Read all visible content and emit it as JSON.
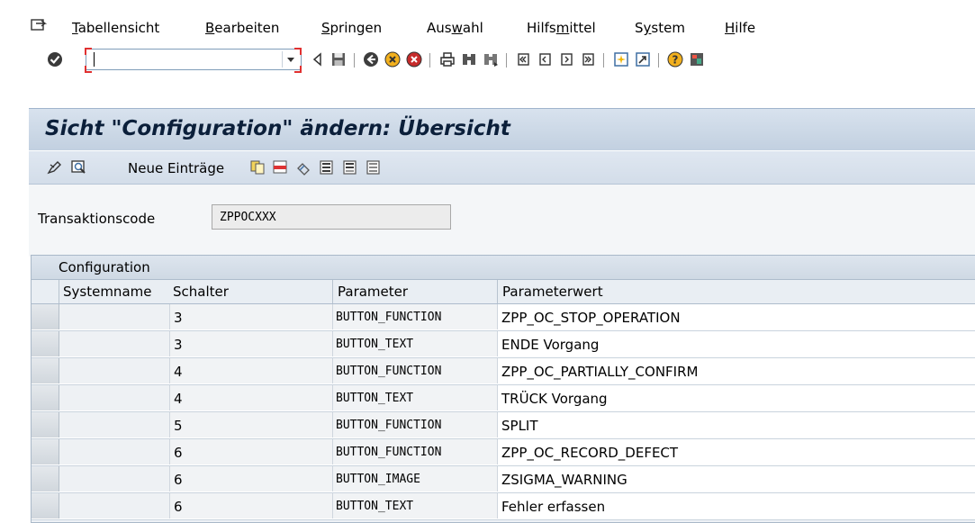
{
  "menu": {
    "items": [
      {
        "pre": "",
        "u": "T",
        "post": "abellensicht"
      },
      {
        "pre": "",
        "u": "B",
        "post": "earbeiten"
      },
      {
        "pre": "",
        "u": "S",
        "post": "pringen"
      },
      {
        "pre": "Aus",
        "u": "w",
        "post": "ahl"
      },
      {
        "pre": "Hilfs",
        "u": "m",
        "post": "ittel"
      },
      {
        "pre": "S",
        "u": "y",
        "post": "stem"
      },
      {
        "pre": "",
        "u": "H",
        "post": "ilfe"
      }
    ]
  },
  "toolbar": {
    "command_field_value": ""
  },
  "screen": {
    "title": "Sicht \"Configuration\" ändern: Übersicht"
  },
  "apptoolbar": {
    "new_entries_label": "Neue Einträge"
  },
  "form": {
    "label": "Transaktionscode",
    "value": "ZPPOCXXX"
  },
  "table": {
    "title": "Configuration",
    "columns": [
      "Systemname",
      "Schalter",
      "Parameter",
      "Parameterwert"
    ],
    "rows": [
      {
        "systemname": "",
        "schalter": "3",
        "parameter": "BUTTON_FUNCTION",
        "parameterwert": "ZPP_OC_STOP_OPERATION"
      },
      {
        "systemname": "",
        "schalter": "3",
        "parameter": "BUTTON_TEXT",
        "parameterwert": "ENDE Vorgang"
      },
      {
        "systemname": "",
        "schalter": "4",
        "parameter": "BUTTON_FUNCTION",
        "parameterwert": "ZPP_OC_PARTIALLY_CONFIRM"
      },
      {
        "systemname": "",
        "schalter": "4",
        "parameter": "BUTTON_TEXT",
        "parameterwert": "TRÜCK Vorgang"
      },
      {
        "systemname": "",
        "schalter": "5",
        "parameter": "BUTTON_FUNCTION",
        "parameterwert": "SPLIT"
      },
      {
        "systemname": "",
        "schalter": "6",
        "parameter": "BUTTON_FUNCTION",
        "parameterwert": "ZPP_OC_RECORD_DEFECT"
      },
      {
        "systemname": "",
        "schalter": "6",
        "parameter": "BUTTON_IMAGE",
        "parameterwert": "ZSIGMA_WARNING"
      },
      {
        "systemname": "",
        "schalter": "6",
        "parameter": "BUTTON_TEXT",
        "parameterwert": "Fehler erfassen"
      }
    ]
  },
  "icons": {
    "menu": "menu-pointer-icon",
    "toolbar": [
      "enter-icon",
      "back-arrow-icon",
      "save-icon",
      "back-icon",
      "exit-icon",
      "cancel-icon",
      "print-icon",
      "find-icon",
      "find-next-icon",
      "first-page-icon",
      "previous-page-icon",
      "next-page-icon",
      "last-page-icon",
      "create-session-icon",
      "shortcut-icon",
      "help-icon",
      "layout-icon"
    ],
    "apptoolbar": [
      "change-display-icon",
      "details-icon",
      "copy-icon",
      "delete-icon",
      "undo-icon",
      "select-all-icon",
      "select-block-icon",
      "deselect-all-icon"
    ]
  },
  "colors": {
    "title_text": "#0b1f3a",
    "title_band": "#c9d6e5",
    "command_field_border": "#e03030"
  }
}
